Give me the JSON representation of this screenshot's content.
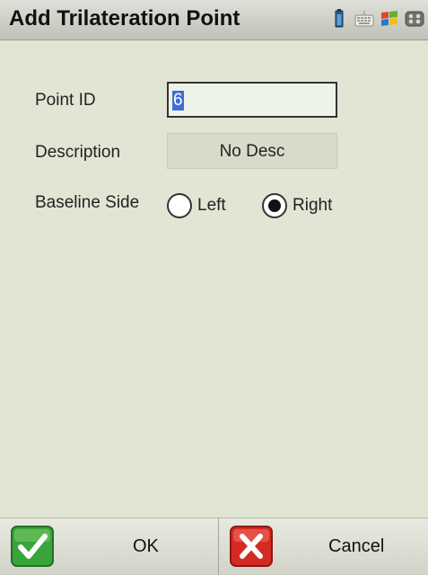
{
  "window": {
    "title": "Add Trilateration Point"
  },
  "system_icons": [
    "battery-icon",
    "keyboard-icon",
    "windows-start-icon",
    "connectivity-icon"
  ],
  "form": {
    "point_id_label": "Point ID",
    "point_id_value": "6",
    "description_label": "Description",
    "description_value": "No Desc",
    "baseline_label": "Baseline Side",
    "baseline_options": {
      "left": "Left",
      "right": "Right"
    },
    "baseline_selected": "Right"
  },
  "buttons": {
    "ok_label": "OK",
    "cancel_label": "Cancel"
  },
  "colors": {
    "background": "#e3e5d4",
    "selection": "#3d6fd6",
    "ok_green": "#3aa33a",
    "cancel_red": "#d52a22"
  }
}
